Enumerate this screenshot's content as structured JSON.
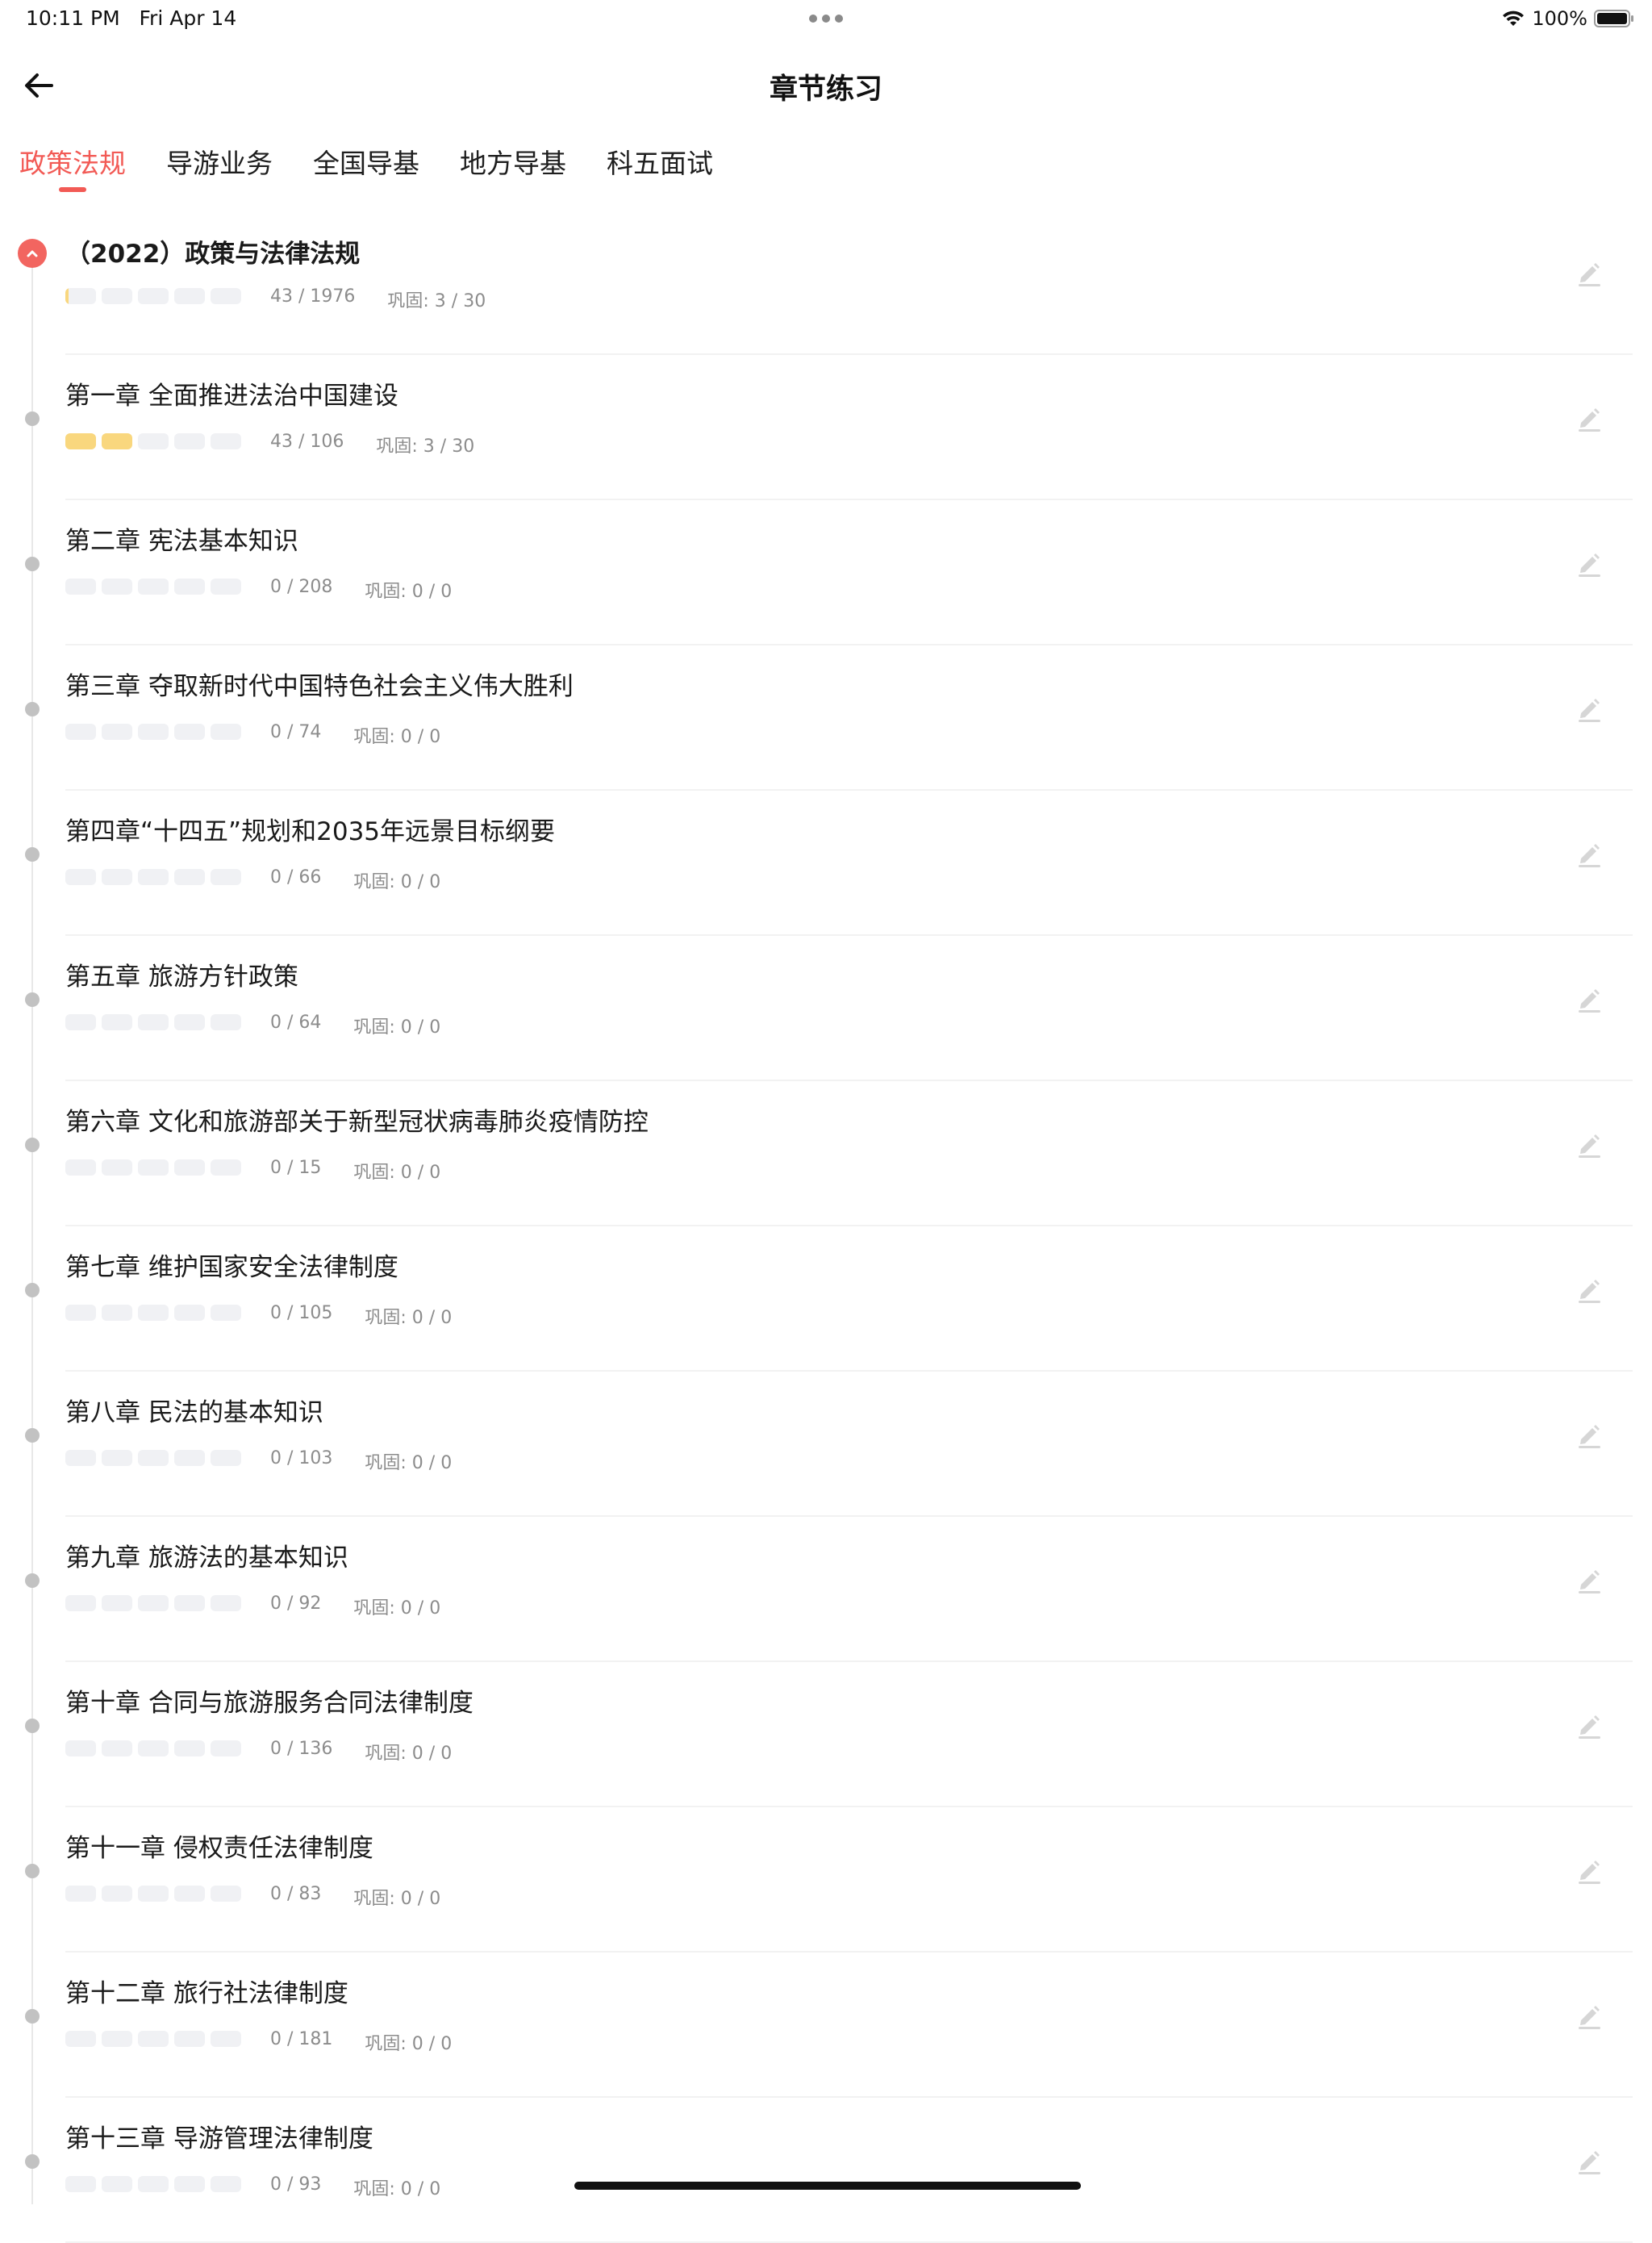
{
  "status_bar": {
    "time": "10:11 PM",
    "date": "Fri Apr 14",
    "battery": "100%"
  },
  "header": {
    "title": "章节练习",
    "back_icon": "arrow-left-icon"
  },
  "tabs": [
    {
      "label": "政策法规",
      "active": true
    },
    {
      "label": "导游业务",
      "active": false
    },
    {
      "label": "全国导基",
      "active": false
    },
    {
      "label": "地方导基",
      "active": false
    },
    {
      "label": "科五面试",
      "active": false
    }
  ],
  "colors": {
    "accent": "#f25a55",
    "progress_fill": "#f9d77e",
    "progress_empty": "#f0f1f4",
    "timeline_dot": "#c2c2c2"
  },
  "chapters": [
    {
      "title": "（2022）政策与法律法规",
      "count": "43 / 1976",
      "review": "巩固: 3 / 30",
      "progress": [
        0.08,
        0,
        0,
        0,
        0
      ],
      "expanded": true
    },
    {
      "title": "第一章 全面推进法治中国建设",
      "count": "43 / 106",
      "review": "巩固: 3 / 30",
      "progress": [
        1,
        1,
        0,
        0,
        0
      ]
    },
    {
      "title": "第二章 宪法基本知识",
      "count": "0 / 208",
      "review": "巩固: 0 / 0",
      "progress": [
        0,
        0,
        0,
        0,
        0
      ]
    },
    {
      "title": "第三章 夺取新时代中国特色社会主义伟大胜利",
      "count": "0 / 74",
      "review": "巩固: 0 / 0",
      "progress": [
        0,
        0,
        0,
        0,
        0
      ]
    },
    {
      "title": "第四章“十四五”规划和2035年远景目标纲要",
      "count": "0 / 66",
      "review": "巩固: 0 / 0",
      "progress": [
        0,
        0,
        0,
        0,
        0
      ]
    },
    {
      "title": "第五章  旅游方针政策",
      "count": "0 / 64",
      "review": "巩固: 0 / 0",
      "progress": [
        0,
        0,
        0,
        0,
        0
      ]
    },
    {
      "title": "第六章  文化和旅游部关于新型冠状病毒肺炎疫情防控",
      "count": "0 / 15",
      "review": "巩固: 0 / 0",
      "progress": [
        0,
        0,
        0,
        0,
        0
      ]
    },
    {
      "title": "第七章  维护国家安全法律制度",
      "count": "0 / 105",
      "review": "巩固: 0 / 0",
      "progress": [
        0,
        0,
        0,
        0,
        0
      ]
    },
    {
      "title": "第八章  民法的基本知识",
      "count": "0 / 103",
      "review": "巩固: 0 / 0",
      "progress": [
        0,
        0,
        0,
        0,
        0
      ]
    },
    {
      "title": "第九章  旅游法的基本知识",
      "count": "0 / 92",
      "review": "巩固: 0 / 0",
      "progress": [
        0,
        0,
        0,
        0,
        0
      ]
    },
    {
      "title": "第十章 合同与旅游服务合同法律制度",
      "count": "0 / 136",
      "review": "巩固: 0 / 0",
      "progress": [
        0,
        0,
        0,
        0,
        0
      ]
    },
    {
      "title": "第十一章  侵权责任法律制度",
      "count": "0 / 83",
      "review": "巩固: 0 / 0",
      "progress": [
        0,
        0,
        0,
        0,
        0
      ]
    },
    {
      "title": "第十二章 旅行社法律制度",
      "count": "0 / 181",
      "review": "巩固: 0 / 0",
      "progress": [
        0,
        0,
        0,
        0,
        0
      ]
    },
    {
      "title": "第十三章  导游管理法律制度",
      "count": "0 / 93",
      "review": "巩固: 0 / 0",
      "progress": [
        0,
        0,
        0,
        0,
        0
      ]
    }
  ]
}
